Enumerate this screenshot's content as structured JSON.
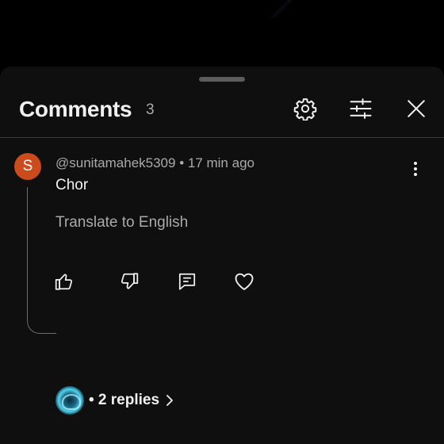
{
  "header": {
    "title": "Comments",
    "count": "3",
    "icons": [
      "gear-icon",
      "sliders-icon",
      "close-icon"
    ]
  },
  "comment": {
    "avatar_letter": "S",
    "avatar_color": "#cc4b1c",
    "meta": "@sunitamahek5309 • 17 min ago",
    "text": "Chor",
    "translate": "Translate to English",
    "actions": [
      "thumbs-up-icon",
      "thumbs-down-icon",
      "reply-icon",
      "heart-icon"
    ],
    "replies_label": "• 2 replies"
  },
  "colors": {
    "background": "#0f0f0f",
    "primary_text": "#f1f1f1",
    "secondary_text": "#aaaaaa"
  }
}
